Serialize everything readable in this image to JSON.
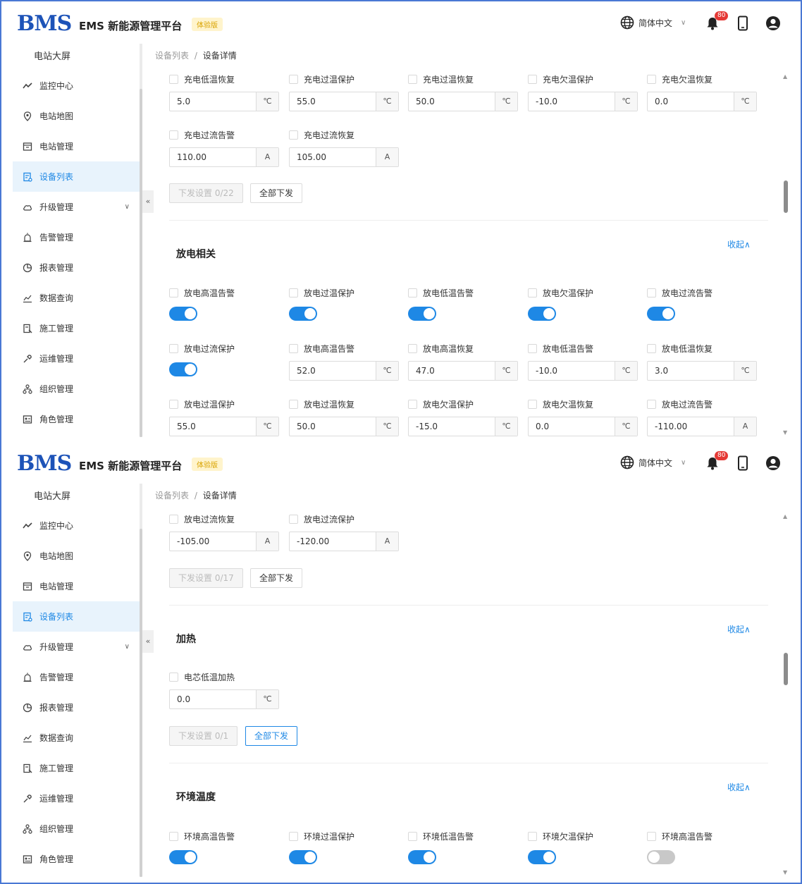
{
  "header": {
    "logo": "BMS",
    "title": "EMS 新能源管理平台",
    "trial_badge": "体验版",
    "language": "简体中文",
    "notifications": "80"
  },
  "sidebar": {
    "top": "电站大屏",
    "items": [
      {
        "label": "监控中心",
        "icon": "chart-line-icon"
      },
      {
        "label": "电站地图",
        "icon": "map-pin-icon"
      },
      {
        "label": "电站管理",
        "icon": "station-icon"
      },
      {
        "label": "设备列表",
        "icon": "device-list-icon",
        "active": true
      },
      {
        "label": "升级管理",
        "icon": "cloud-upgrade-icon",
        "expandable": true
      },
      {
        "label": "告警管理",
        "icon": "alarm-icon"
      },
      {
        "label": "报表管理",
        "icon": "report-icon"
      },
      {
        "label": "数据查询",
        "icon": "data-query-icon"
      },
      {
        "label": "施工管理",
        "icon": "construction-icon"
      },
      {
        "label": "运维管理",
        "icon": "maintenance-icon"
      },
      {
        "label": "组织管理",
        "icon": "org-icon"
      },
      {
        "label": "角色管理",
        "icon": "role-icon"
      }
    ]
  },
  "breadcrumb": {
    "parent": "设备列表",
    "separator": "/",
    "current": "设备详情"
  },
  "panel1": {
    "charge_row1": [
      {
        "label": "充电低温恢复",
        "value": "5.0",
        "unit": "℃"
      },
      {
        "label": "充电过温保护",
        "value": "55.0",
        "unit": "℃"
      },
      {
        "label": "充电过温恢复",
        "value": "50.0",
        "unit": "℃"
      },
      {
        "label": "充电欠温保护",
        "value": "-10.0",
        "unit": "℃"
      },
      {
        "label": "充电欠温恢复",
        "value": "0.0",
        "unit": "℃"
      }
    ],
    "charge_row2": [
      {
        "label": "充电过流告警",
        "value": "110.00",
        "unit": "A"
      },
      {
        "label": "充电过流恢复",
        "value": "105.00",
        "unit": "A"
      }
    ],
    "send_button": "下发设置 0/22",
    "send_all_button": "全部下发",
    "discharge_title": "放电相关",
    "collapse": "收起∧",
    "discharge_row1": [
      {
        "label": "放电高温告警",
        "toggle": true
      },
      {
        "label": "放电过温保护",
        "toggle": true
      },
      {
        "label": "放电低温告警",
        "toggle": true
      },
      {
        "label": "放电欠温保护",
        "toggle": true
      },
      {
        "label": "放电过流告警",
        "toggle": true
      }
    ],
    "discharge_row2": [
      {
        "label": "放电过流保护",
        "toggle": true
      },
      {
        "label": "放电高温告警",
        "value": "52.0",
        "unit": "℃"
      },
      {
        "label": "放电高温恢复",
        "value": "47.0",
        "unit": "℃"
      },
      {
        "label": "放电低温告警",
        "value": "-10.0",
        "unit": "℃"
      },
      {
        "label": "放电低温恢复",
        "value": "3.0",
        "unit": "℃"
      }
    ],
    "discharge_row3": [
      {
        "label": "放电过温保护",
        "value": "55.0",
        "unit": "℃"
      },
      {
        "label": "放电过温恢复",
        "value": "50.0",
        "unit": "℃"
      },
      {
        "label": "放电欠温保护",
        "value": "-15.0",
        "unit": "℃"
      },
      {
        "label": "放电欠温恢复",
        "value": "0.0",
        "unit": "℃"
      },
      {
        "label": "放电过流告警",
        "value": "-110.00",
        "unit": "A"
      }
    ]
  },
  "panel2": {
    "discharge_row": [
      {
        "label": "放电过流恢复",
        "value": "-105.00",
        "unit": "A"
      },
      {
        "label": "放电过流保护",
        "value": "-120.00",
        "unit": "A"
      }
    ],
    "send_button": "下发设置 0/17",
    "send_all_button": "全部下发",
    "heating_title": "加热",
    "collapse": "收起∧",
    "heating_row": [
      {
        "label": "电芯低温加热",
        "value": "0.0",
        "unit": "℃"
      }
    ],
    "heating_send_button": "下发设置 0/1",
    "heating_send_all_button": "全部下发",
    "env_title": "环境温度",
    "env_collapse": "收起∧",
    "env_row": [
      {
        "label": "环境高温告警",
        "toggle": true
      },
      {
        "label": "环境过温保护",
        "toggle": true
      },
      {
        "label": "环境低温告警",
        "toggle": true
      },
      {
        "label": "环境欠温保护",
        "toggle": true
      },
      {
        "label": "环境高温告警",
        "toggle": false
      }
    ]
  }
}
